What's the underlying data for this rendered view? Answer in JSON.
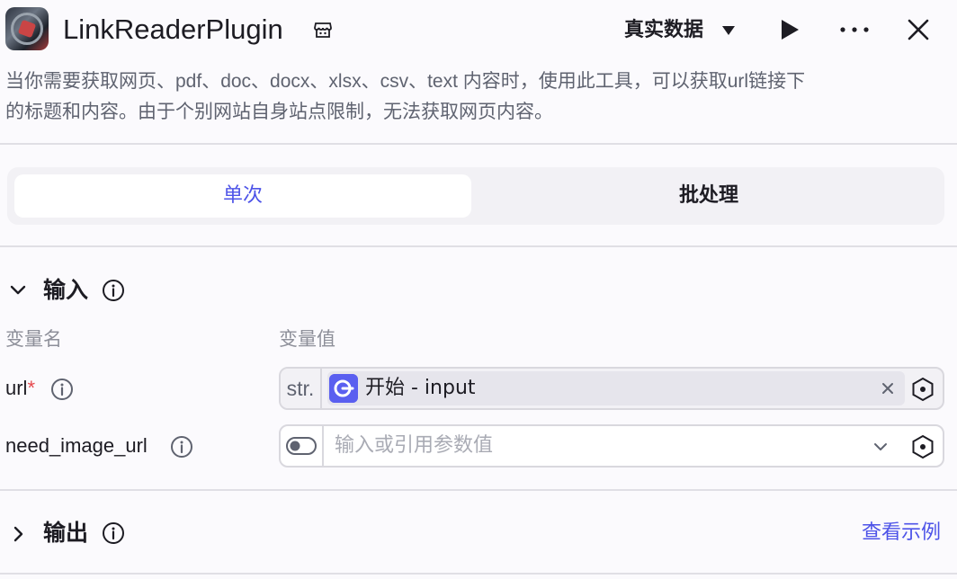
{
  "header": {
    "title": "LinkReaderPlugin",
    "data_mode_label": "真实数据"
  },
  "description": {
    "line1": "当你需要获取网页、pdf、doc、docx、xlsx、csv、text 内容时，使用此工具，可以获取url链接下",
    "line2": "的标题和内容。由于个别网站自身站点限制，无法获取网页内容。"
  },
  "tabs": [
    {
      "label": "单次",
      "active": true
    },
    {
      "label": "批处理",
      "active": false
    }
  ],
  "input_section": {
    "title": "输入",
    "col_name": "变量名",
    "col_value": "变量值",
    "params": [
      {
        "name": "url",
        "required_mark": "*",
        "type_tag": "str.",
        "ref_text": "开始 - input"
      },
      {
        "name": "need_image_url",
        "placeholder": "输入或引用参数值"
      }
    ]
  },
  "output_section": {
    "title": "输出",
    "view_example_label": "查看示例"
  },
  "colors": {
    "accent": "#4d53e8",
    "required": "#e5484d",
    "ref_icon_bg": "#5a5ff0"
  },
  "icons": [
    "store-icon",
    "caret-down-icon",
    "play-icon",
    "more-icon",
    "close-icon",
    "info-icon",
    "chevron-down-icon",
    "chevron-right-icon",
    "variable-ref-icon",
    "clear-icon",
    "toggle-icon",
    "dropdown-icon"
  ]
}
